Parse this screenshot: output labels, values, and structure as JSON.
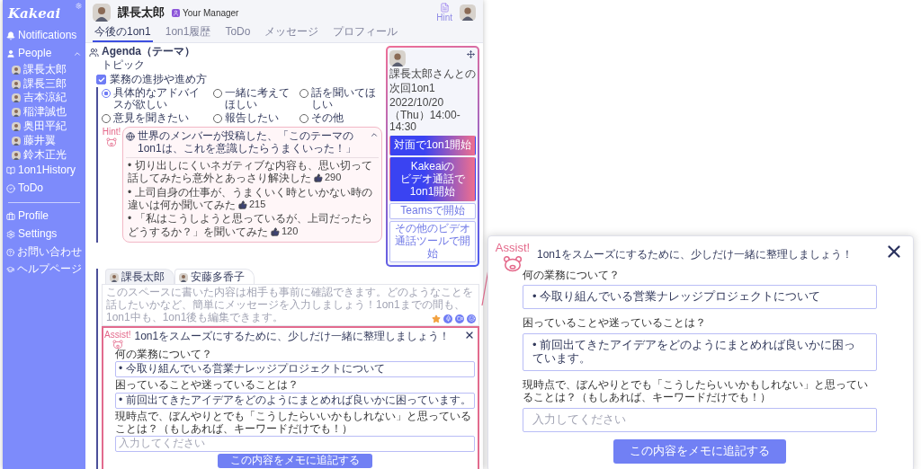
{
  "sidebar": {
    "logo": "Kakeai",
    "nav": [
      {
        "label": "Notifications"
      }
    ],
    "people": {
      "label": "People",
      "expanded": true,
      "members": [
        {
          "name": "課長太郎"
        },
        {
          "name": "課長三郎"
        },
        {
          "name": "吉本涼紀"
        },
        {
          "name": "稲津誠也"
        },
        {
          "name": "奥田平紀"
        },
        {
          "name": "藤井翼"
        },
        {
          "name": "鈴木正光"
        }
      ]
    },
    "more": [
      {
        "label": "1on1History"
      },
      {
        "label": "ToDo"
      }
    ],
    "footer": [
      {
        "label": "Profile"
      },
      {
        "label": "Settings"
      },
      {
        "label": "お問い合わせ"
      },
      {
        "label": "ヘルプページ"
      }
    ]
  },
  "header": {
    "name": "課長太郎",
    "role": "Your Manager",
    "hint_label": "Hint"
  },
  "tabs": [
    {
      "label": "今後の1on1",
      "selected": true
    },
    {
      "label": "1on1履歴",
      "selected": false
    },
    {
      "label": "ToDo",
      "selected": false
    },
    {
      "label": "メッセージ",
      "selected": false
    },
    {
      "label": "プロフィール",
      "selected": false
    }
  ],
  "agenda": {
    "heading": "Agenda（テーマ）",
    "topic_label": "トピック",
    "topic": {
      "label": "業務の進捗や進め方",
      "checked": true,
      "options": [
        {
          "label": "具体的なアドバイスが欲しい",
          "selected": true
        },
        {
          "label": "一緒に考えてほしい",
          "selected": false
        },
        {
          "label": "話を聞いてほしい",
          "selected": false
        },
        {
          "label": "意見を聞きたい",
          "selected": false
        },
        {
          "label": "報告したい",
          "selected": false
        },
        {
          "label": "その他",
          "selected": false
        }
      ]
    },
    "hint": {
      "badge": "Hint!",
      "title": "世界のメンバーが投稿した、「このテーマの1on1は、これを意識したらうまくいった！」",
      "expanded": true,
      "tips": [
        {
          "text": "• 切り出しにくいネガティブな内容も、思い切って話してみたら意外とあっさり解決した",
          "likes": "290"
        },
        {
          "text": "• 上司自身の仕事が、うまくいく時といかない時の違いは何か聞いてみた",
          "likes": "215"
        },
        {
          "text": "• 「私はこうしようと思っているが、上司だったらどうするか？」を聞いてみた",
          "likes": "120"
        }
      ]
    }
  },
  "next_meeting": {
    "with": "課長太郎さんとの",
    "label": "次回1on1",
    "datetime": "2022/10/20（Thu）14:00-14:30",
    "buttons": [
      {
        "kind": "primary",
        "lines": [
          "対面で1on1開始"
        ]
      },
      {
        "kind": "primary",
        "lines": [
          "Kakeaiの",
          "ビデオ通話で1on1開始"
        ]
      },
      {
        "kind": "secondary",
        "lines": [
          "Teamsで開始"
        ]
      },
      {
        "kind": "secondary",
        "lines": [
          "その他のビデオ通話ツールで開始"
        ]
      }
    ]
  },
  "memo": {
    "tabs": [
      {
        "name": "課長太郎",
        "selected": false
      },
      {
        "name": "安藤多香子",
        "selected": true
      }
    ],
    "placeholder": "このスペースに書いた内容は相手も事前に確認できます。どのようなことを話したいかなど、簡単にメッセージを入力しましょう！1on1までの間も、1on1中も、1on1後も編集できます。"
  },
  "assist": {
    "badge": "Assist!",
    "title": "1on1をスムーズにするために、少しだけ一緒に整理しましょう！",
    "questions": [
      {
        "label": "何の業務について？",
        "value": "• 今取り組んでいる営業ナレッジプロジェクトについて"
      },
      {
        "label": "困っていることや迷っていることは？",
        "value": "• 前回出てきたアイデアをどのようにまとめれば良いかに困っています。"
      },
      {
        "label": "現時点で、ぼんやりとでも「こうしたらいいかもしれない」と思っていることは？（もしあれば、キーワードだけでも！）",
        "placeholder": "入力してください"
      }
    ],
    "submit": "この内容をメモに追記する"
  },
  "assist_zoom": {
    "badge": "Assist!",
    "title": "1on1をスムーズにするために、少しだけ一緒に整理しましょう！",
    "questions": [
      {
        "label": "何の業務について？",
        "value": "• 今取り組んでいる営業ナレッジプロジェクトについて"
      },
      {
        "label": "困っていることや迷っていることは？",
        "value": "• 前回出てきたアイデアをどのようにまとめれば良いかに困っています。"
      },
      {
        "label": "現時点で、ぼんやりとでも「こうしたらいいかもしれない」と思っていることは？（もしあれば、キーワードだけでも！）",
        "placeholder": "入力してください"
      }
    ],
    "submit": "この内容をメモに追記する"
  }
}
